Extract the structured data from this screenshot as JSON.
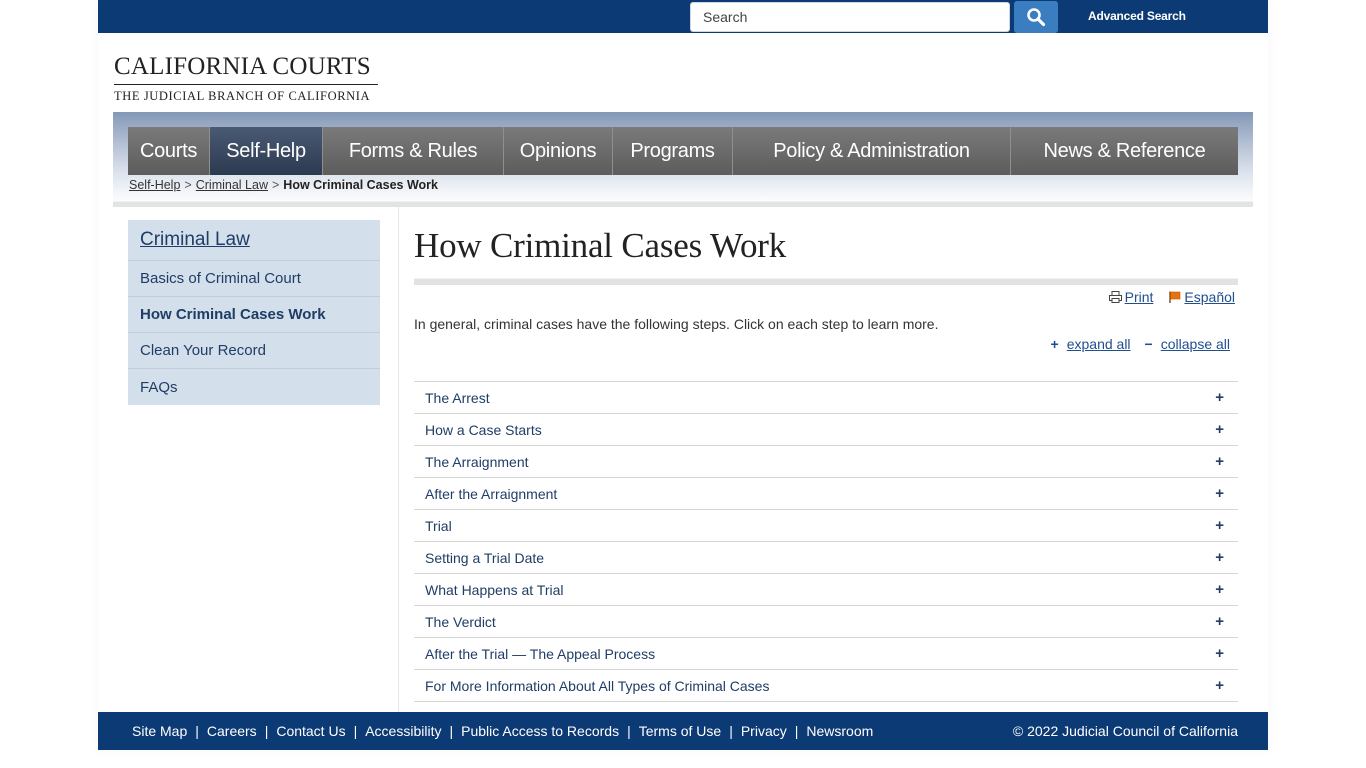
{
  "header": {
    "search_placeholder": "Search",
    "search_value": "",
    "search_icon": "magnifier-icon",
    "advanced_search": "Advanced Search"
  },
  "logo": {
    "title": "CALIFORNIA COURTS",
    "subtitle": "THE JUDICIAL BRANCH OF CALIFORNIA"
  },
  "nav": {
    "items": [
      {
        "label": "Courts",
        "active": false
      },
      {
        "label": "Self-Help",
        "active": true
      },
      {
        "label": "Forms & Rules",
        "active": false
      },
      {
        "label": "Opinions",
        "active": false
      },
      {
        "label": "Programs",
        "active": false
      },
      {
        "label": "Policy & Administration",
        "active": false
      },
      {
        "label": "News & Reference",
        "active": false
      }
    ]
  },
  "breadcrumb": {
    "items": [
      "Self-Help",
      "Criminal Law"
    ],
    "separator": ">",
    "current": "How Criminal Cases Work"
  },
  "sidebar": {
    "heading": "Criminal Law",
    "items": [
      {
        "label": "Basics of Criminal Court",
        "active": false
      },
      {
        "label": "How Criminal Cases Work",
        "active": true
      },
      {
        "label": "Clean Your Record",
        "active": false
      },
      {
        "label": "FAQs",
        "active": false
      }
    ]
  },
  "main": {
    "title": "How Criminal Cases Work",
    "tools": {
      "print": "Print",
      "print_icon": "printer-icon",
      "language": "Español",
      "language_icon": "flag-icon"
    },
    "intro": "In general, criminal cases have the following steps. Click on each step to learn more.",
    "expand_symbol": "+",
    "expand_all": "expand all",
    "collapse_symbol": "−",
    "collapse_all": "collapse all",
    "steps": [
      {
        "label": "The Arrest",
        "toggle": "+"
      },
      {
        "label": "How a Case Starts",
        "toggle": "+"
      },
      {
        "label": "The Arraignment",
        "toggle": "+"
      },
      {
        "label": "After the Arraignment",
        "toggle": "+"
      },
      {
        "label": "Trial",
        "toggle": "+"
      },
      {
        "label": "Setting a Trial Date",
        "toggle": "+"
      },
      {
        "label": "What Happens at Trial",
        "toggle": "+"
      },
      {
        "label": "The Verdict",
        "toggle": "+"
      },
      {
        "label": "After the Trial — The Appeal Process",
        "toggle": "+"
      },
      {
        "label": "For More Information About All Types of Criminal Cases",
        "toggle": "+"
      }
    ]
  },
  "footer": {
    "links": [
      "Site Map",
      "Careers",
      "Contact Us",
      "Accessibility",
      "Public Access to Records",
      "Terms of Use",
      "Privacy",
      "Newsroom"
    ],
    "separator": "|",
    "copyright": "© 2022 Judicial Council of California"
  },
  "colors": {
    "brand_navy": "#0b3a75",
    "search_button": "#3b7dc1",
    "sidebar_bg": "#d3dfea",
    "link_blue": "#1f4f8f",
    "nav_gray": "#6a6a6a",
    "nav_active": "#3a4a62"
  }
}
